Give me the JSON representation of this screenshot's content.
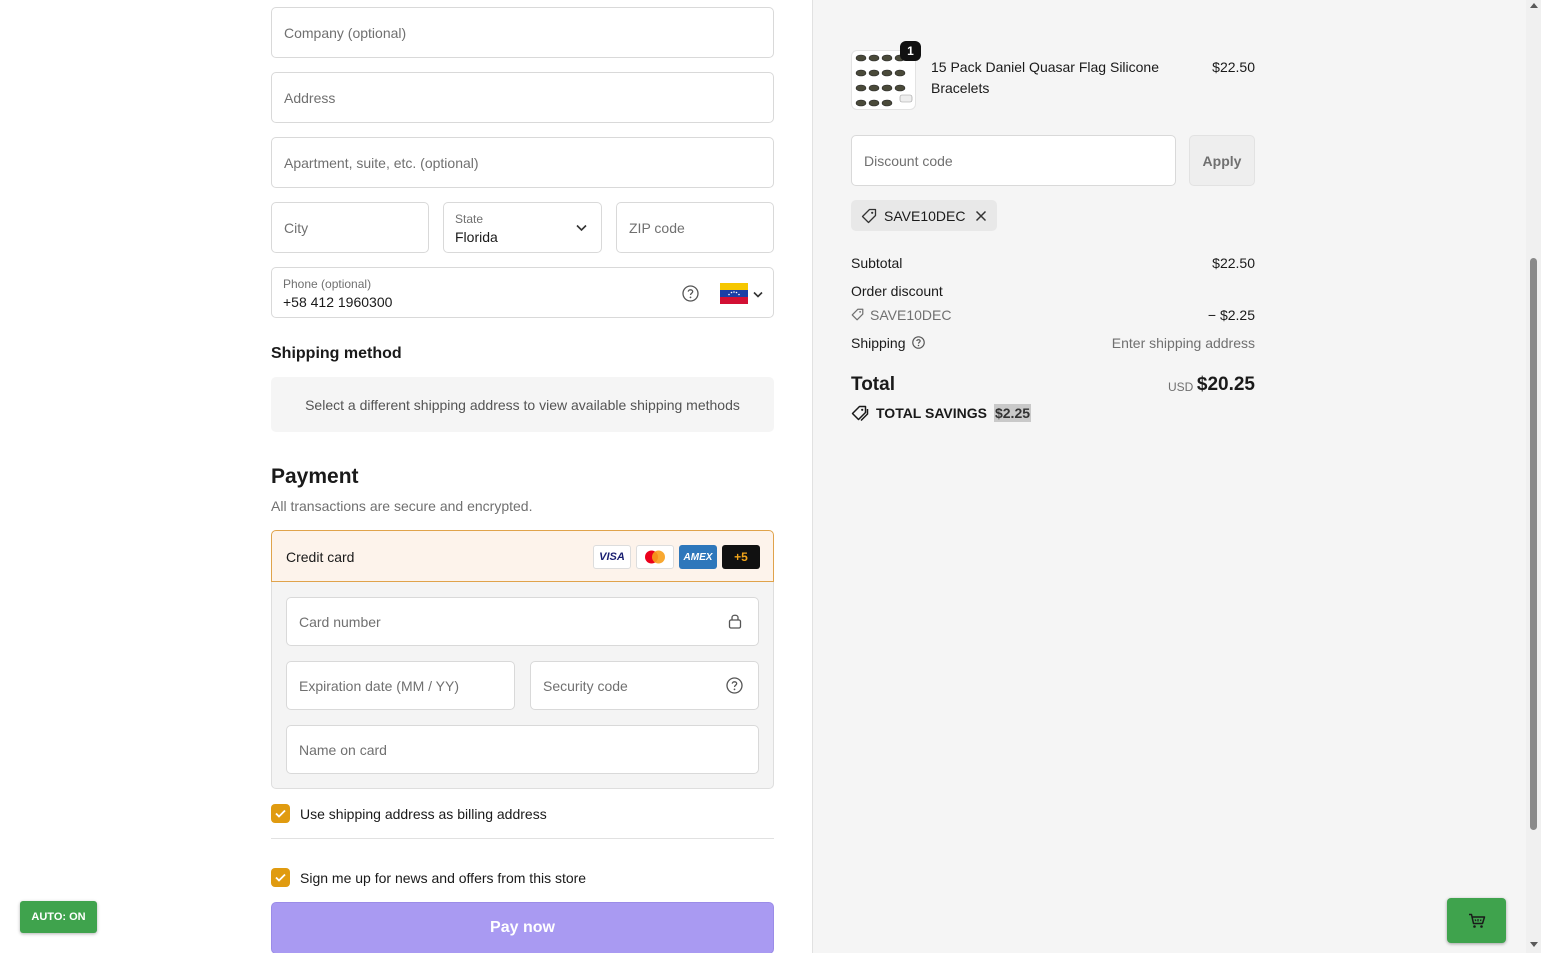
{
  "form": {
    "company_placeholder": "Company (optional)",
    "address_placeholder": "Address",
    "apartment_placeholder": "Apartment, suite, etc. (optional)",
    "city_placeholder": "City",
    "state_label": "State",
    "state_value": "Florida",
    "zip_placeholder": "ZIP code",
    "phone_label": "Phone (optional)",
    "phone_value": "+58 412 1960300",
    "phone_country_flag": "venezuela-flag"
  },
  "shipping": {
    "heading": "Shipping method",
    "message": "Select a different shipping address to view available shipping methods"
  },
  "payment": {
    "heading": "Payment",
    "subtext": "All transactions are secure and encrypted.",
    "method_label": "Credit card",
    "brands": [
      "VISA",
      "Mastercard",
      "AMEX",
      "+5"
    ],
    "card_number_placeholder": "Card number",
    "expiration_placeholder": "Expiration date (MM / YY)",
    "security_placeholder": "Security code",
    "name_placeholder": "Name on card",
    "billing_same_label": "Use shipping address as billing address",
    "billing_same_checked": true,
    "newsletter_label": "Sign me up for news and offers from this store",
    "newsletter_checked": true,
    "pay_button": "Pay now",
    "accent_color": "#e09b10",
    "pay_button_color": "#a99af2"
  },
  "overlay": {
    "auto_badge": "AUTO: ON",
    "cart_icon": "cart-icon"
  },
  "summary": {
    "product": {
      "quantity": "1",
      "name": "15 Pack Daniel Quasar Flag Silicone Bracelets",
      "price": "$22.50"
    },
    "discount_placeholder": "Discount code",
    "apply_label": "Apply",
    "applied_code": "SAVE10DEC",
    "subtotal_label": "Subtotal",
    "subtotal_value": "$22.50",
    "order_discount_label": "Order discount",
    "discount_code": "SAVE10DEC",
    "discount_value": "− $2.25",
    "shipping_label": "Shipping",
    "shipping_value": "Enter shipping address",
    "total_label": "Total",
    "total_currency": "USD",
    "total_value": "$20.25",
    "savings_label": "TOTAL SAVINGS",
    "savings_value": "$2.25"
  }
}
